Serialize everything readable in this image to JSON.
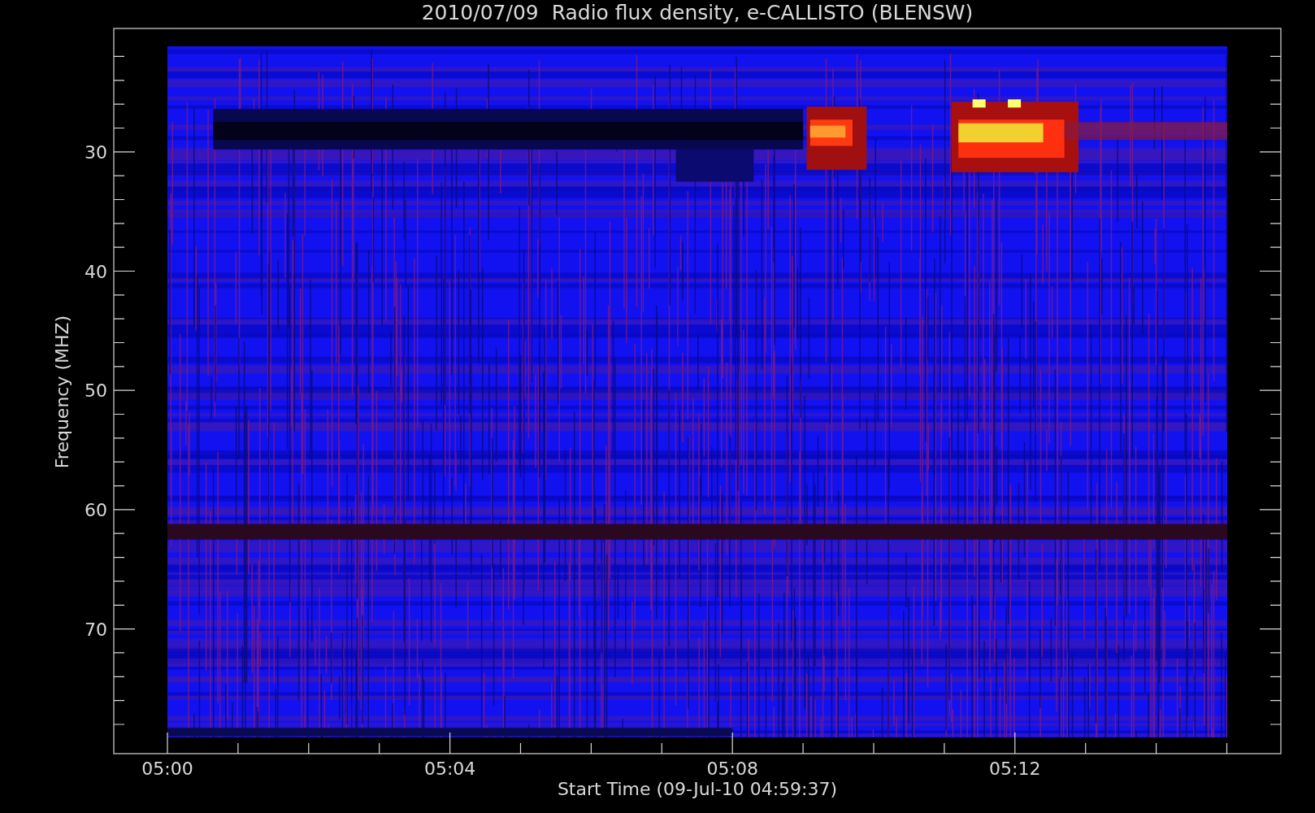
{
  "title": "2010/07/09  Radio flux density, e-CALLISTO (BLENSW)",
  "ylabel": "Frequency (MHZ)",
  "xlabel": "Start Time (09-Jul-10 04:59:37)",
  "yticks": [
    "30",
    "40",
    "50",
    "60",
    "70"
  ],
  "xticks": [
    "05:00",
    "05:04",
    "05:08",
    "05:12"
  ]
}
